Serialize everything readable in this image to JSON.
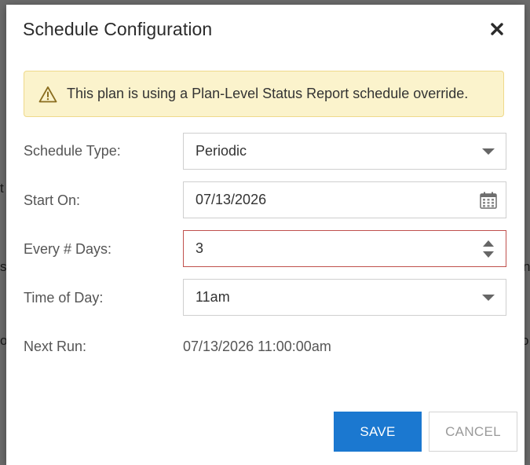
{
  "dialog": {
    "title": "Schedule Configuration",
    "close_icon": "close-icon"
  },
  "alert": {
    "icon": "warning-triangle-icon",
    "message": "This plan is using a Plan-Level Status Report schedule override."
  },
  "form": {
    "schedule_type": {
      "label": "Schedule Type:",
      "value": "Periodic"
    },
    "start_on": {
      "label": "Start On:",
      "value": "07/13/2026",
      "icon": "calendar-icon"
    },
    "every_days": {
      "label": "Every # Days:",
      "value": "3"
    },
    "time_of_day": {
      "label": "Time of Day:",
      "value": "11am"
    },
    "next_run": {
      "label": "Next Run:",
      "value": "07/13/2026 11:00:00am"
    }
  },
  "buttons": {
    "save": "SAVE",
    "cancel": "CANCEL"
  },
  "colors": {
    "primary": "#1b78d0",
    "alert_bg": "#fbf3cc",
    "alert_border": "#efd98b",
    "error_border": "#c0504d"
  }
}
